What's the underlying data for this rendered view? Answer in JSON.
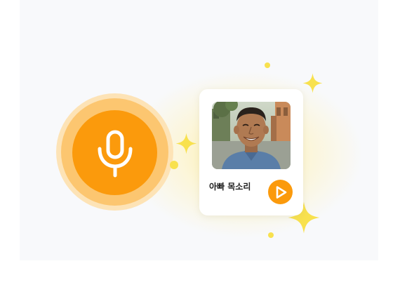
{
  "voice_card": {
    "label": "아빠 목소리"
  },
  "icons": {
    "mic": "microphone-icon",
    "play": "play-icon",
    "sparkle": "sparkle-icon"
  },
  "colors": {
    "accent": "#fb9a0c",
    "sparkle": "#f8e14e",
    "background": "#f8f9fb"
  }
}
